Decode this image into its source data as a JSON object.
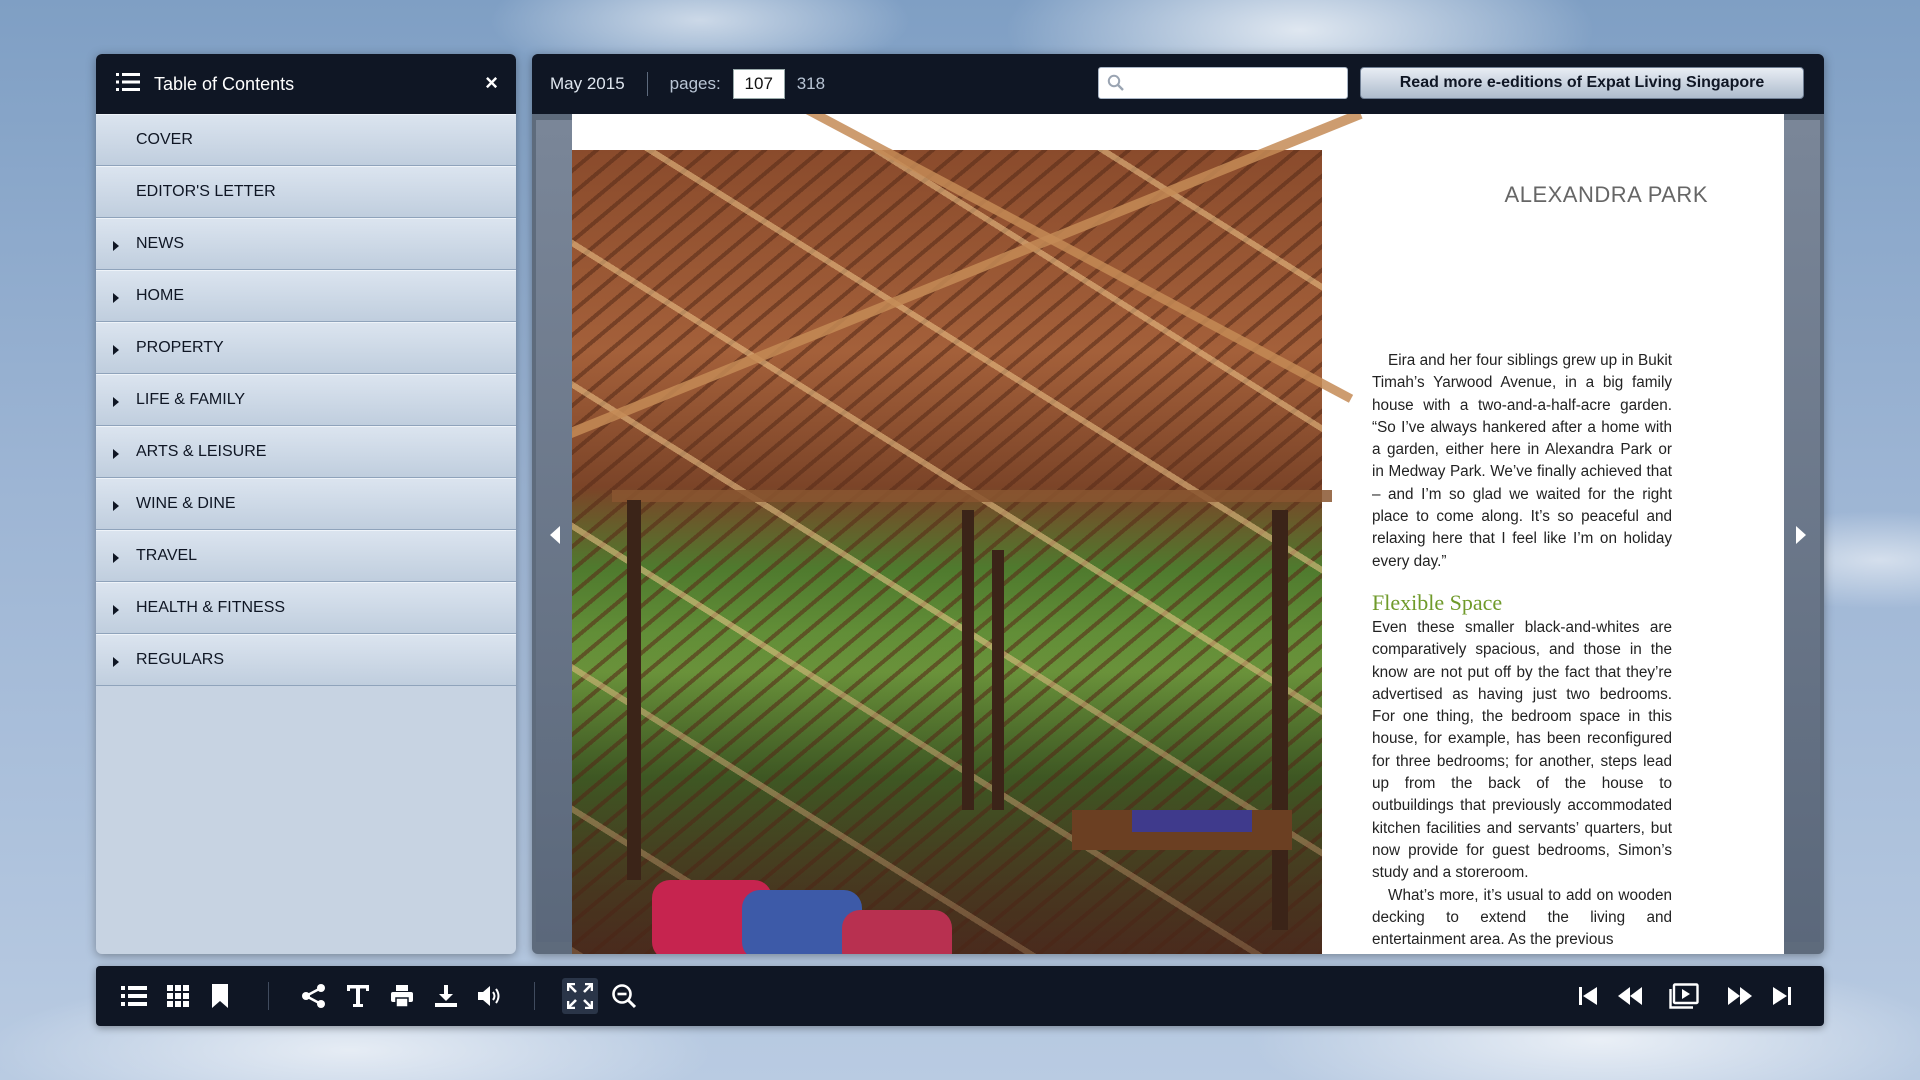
{
  "toc": {
    "title": "Table of Contents",
    "close_label": "×",
    "items": [
      {
        "label": "COVER",
        "expandable": false
      },
      {
        "label": "EDITOR'S LETTER",
        "expandable": false
      },
      {
        "label": "NEWS",
        "expandable": true
      },
      {
        "label": "HOME",
        "expandable": true
      },
      {
        "label": "PROPERTY",
        "expandable": true
      },
      {
        "label": "LIFE & FAMILY",
        "expandable": true
      },
      {
        "label": "ARTS & LEISURE",
        "expandable": true
      },
      {
        "label": "WINE & DINE",
        "expandable": true
      },
      {
        "label": "TRAVEL",
        "expandable": true
      },
      {
        "label": "HEALTH & FITNESS",
        "expandable": true
      },
      {
        "label": "REGULARS",
        "expandable": true
      }
    ]
  },
  "reader": {
    "issue": "May 2015",
    "pages_label": "pages:",
    "current_page": "107",
    "total_pages": "318",
    "search_placeholder": "",
    "more_button": "Read more e-editions of Expat Living Singapore"
  },
  "article": {
    "title": "ALEXANDRA PARK",
    "para1": "Eira and her four siblings grew up in Bukit Timah’s Yarwood Avenue, in a big family house with a two-and-a-half-acre garden. “So I’ve always hankered after a home with a garden, either here in Alexandra Park or in Medway Park. We’ve finally achieved that – and I’m so glad we waited for the right place to come along. It’s so peaceful and relaxing here that I feel like I’m on holiday every day.”",
    "subhead": "Flexible Space",
    "para2": "Even these smaller black-and-whites are comparatively spacious, and those in the know are not put off by the fact that they’re advertised as having just two bedrooms. For one thing, the bedroom space in this house, for example, has been reconfigured for three bedrooms; for another, steps lead up from the back of the house to outbuildings that previously accommodated kitchen facilities and servants’ quarters, but now provide for guest bedrooms, Simon’s study and a storeroom.",
    "para3": "What’s more, it’s usual to add on wooden decking to extend the living and entertainment area. As the previous"
  },
  "toolbar": {
    "icons": [
      "toc-list-icon",
      "thumbnails-grid-icon",
      "bookmark-icon",
      "share-icon",
      "text-icon",
      "print-icon",
      "download-icon",
      "sound-icon",
      "fullscreen-icon",
      "zoom-out-icon",
      "first-page-icon",
      "previous-page-icon",
      "single-page-view-icon",
      "next-page-icon",
      "last-page-icon"
    ]
  },
  "colors": {
    "header_bg": "#0f1624",
    "toc_item_bg": "#c7d3e2",
    "subhead_green": "#6f9a2a",
    "title_gray": "#666666"
  }
}
